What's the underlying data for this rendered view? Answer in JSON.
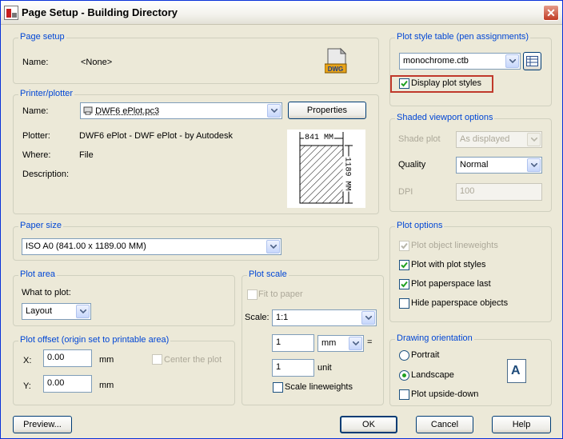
{
  "window": {
    "title": "Page Setup - Building Directory",
    "close": "✕"
  },
  "page_setup": {
    "legend": "Page setup",
    "name_label": "Name:",
    "name_value": "<None>",
    "icon_text": "DWG"
  },
  "printer": {
    "legend": "Printer/plotter",
    "name_label": "Name:",
    "name_value": "DWF6 ePlot.pc3",
    "properties_button": "Properties",
    "plotter_label": "Plotter:",
    "plotter_value": "DWF6 ePlot - DWF ePlot - by Autodesk",
    "where_label": "Where:",
    "where_value": "File",
    "description_label": "Description:",
    "preview_width": "841 MM",
    "preview_height": "1189 MM"
  },
  "paper_size": {
    "legend": "Paper size",
    "value": "ISO A0 (841.00 x 1189.00 MM)"
  },
  "plot_area": {
    "legend": "Plot area",
    "what_label": "What to plot:",
    "what_value": "Layout"
  },
  "plot_offset": {
    "legend": "Plot offset (origin set to printable area)",
    "x_label": "X:",
    "x_value": "0.00",
    "x_unit": "mm",
    "y_label": "Y:",
    "y_value": "0.00",
    "y_unit": "mm",
    "center_label": "Center the plot"
  },
  "plot_scale": {
    "legend": "Plot scale",
    "fit_label": "Fit to paper",
    "scale_label": "Scale:",
    "scale_value": "1:1",
    "value1": "1",
    "unit1": "mm",
    "equals": "=",
    "value2": "1",
    "unit2": "unit",
    "lineweights_label": "Scale lineweights"
  },
  "plot_style_table": {
    "legend": "Plot style table (pen assignments)",
    "value": "monochrome.ctb",
    "display_label": "Display plot styles"
  },
  "shaded_viewport": {
    "legend": "Shaded viewport options",
    "shade_label": "Shade plot",
    "shade_value": "As displayed",
    "quality_label": "Quality",
    "quality_value": "Normal",
    "dpi_label": "DPI",
    "dpi_value": "100"
  },
  "plot_options": {
    "legend": "Plot options",
    "items": [
      {
        "label": "Plot object lineweights",
        "checked": true,
        "disabled": true
      },
      {
        "label": "Plot with plot styles",
        "checked": true,
        "disabled": false
      },
      {
        "label": "Plot paperspace last",
        "checked": true,
        "disabled": false
      },
      {
        "label": "Hide paperspace objects",
        "checked": false,
        "disabled": false
      }
    ]
  },
  "drawing_orientation": {
    "legend": "Drawing orientation",
    "portrait": "Portrait",
    "landscape": "Landscape",
    "upside_down": "Plot upside-down",
    "icon_letter": "A"
  },
  "buttons": {
    "preview": "Preview...",
    "ok": "OK",
    "cancel": "Cancel",
    "help": "Help"
  },
  "colors": {
    "legend": "#0046d5",
    "dialog_bg": "#ece9d8",
    "highlight": "#c0392b",
    "check": "#21a121"
  }
}
